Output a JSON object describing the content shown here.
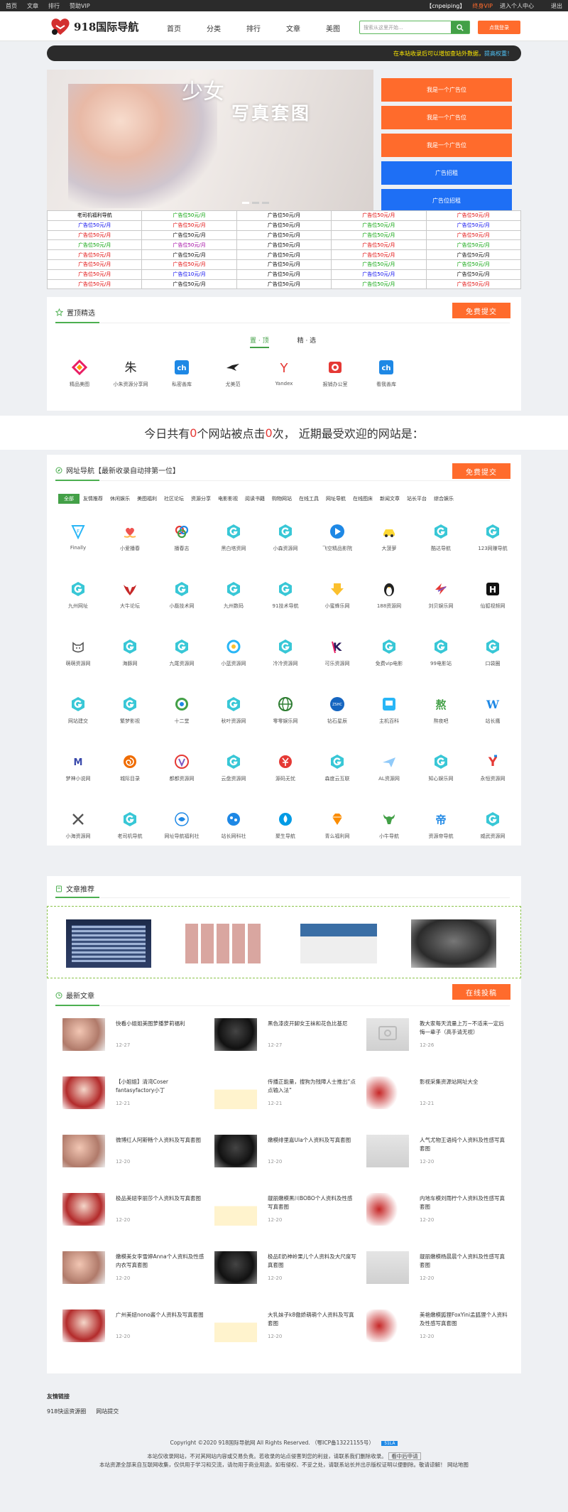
{
  "topbar": {
    "links": [
      "首页",
      "文章",
      "排行",
      "赞助VIP"
    ],
    "user": "【cnpeiping】",
    "vip": "终身VIP",
    "enter": "进入个人中心",
    "logout": "退出"
  },
  "header": {
    "logo_text": "918国际导航",
    "nav": [
      "首页",
      "分类",
      "排行",
      "文章",
      "美图"
    ],
    "search_placeholder": "搜索从这里开始...",
    "signin_label": "点我登录"
  },
  "notice": {
    "text": "在本站收录后可以增加查站外数据，",
    "highlight": "提高权重！"
  },
  "banner": {
    "brand": "少女",
    "title": "写真套图"
  },
  "side_ads": [
    {
      "label": "我是一个广告位",
      "color": "#ff6b2c"
    },
    {
      "label": "我是一个广告位",
      "color": "#ff6b2c"
    },
    {
      "label": "我是一个广告位",
      "color": "#ff6b2c"
    },
    {
      "label": "广告招租",
      "color": "#1e6ff5"
    },
    {
      "label": "广告位招租",
      "color": "#1e6ff5"
    }
  ],
  "ad_table": [
    [
      {
        "t": "老司机福利导航",
        "c": "#000"
      },
      {
        "t": "广告位50元/月",
        "c": "#00a000"
      },
      {
        "t": "广告位50元/月",
        "c": "#000"
      },
      {
        "t": "广告位50元/月",
        "c": "#e00000"
      },
      {
        "t": "广告位50元/月",
        "c": "#e00000"
      }
    ],
    [
      {
        "t": "广告位50元/月",
        "c": "#0000ee"
      },
      {
        "t": "广告位50元/月",
        "c": "#e00000"
      },
      {
        "t": "广告位50元/月",
        "c": "#000"
      },
      {
        "t": "广告位50元/月",
        "c": "#00a000"
      },
      {
        "t": "广告位50元/月",
        "c": "#0000ee"
      }
    ],
    [
      {
        "t": "广告位50元/月",
        "c": "#e00000"
      },
      {
        "t": "广告位50元/月",
        "c": "#000"
      },
      {
        "t": "广告位50元/月",
        "c": "#000"
      },
      {
        "t": "广告位50元/月",
        "c": "#00a000"
      },
      {
        "t": "广告位50元/月",
        "c": "#e00000"
      }
    ],
    [
      {
        "t": "广告位50元/月",
        "c": "#00a000"
      },
      {
        "t": "广告位50元/月",
        "c": "#a000a0"
      },
      {
        "t": "广告位50元/月",
        "c": "#000"
      },
      {
        "t": "广告位50元/月",
        "c": "#e00000"
      },
      {
        "t": "广告位50元/月",
        "c": "#00a000"
      }
    ],
    [
      {
        "t": "广告位50元/月",
        "c": "#e00000"
      },
      {
        "t": "广告位50元/月",
        "c": "#000"
      },
      {
        "t": "广告位50元/月",
        "c": "#000"
      },
      {
        "t": "广告位50元/月",
        "c": "#e00000"
      },
      {
        "t": "广告位50元/月",
        "c": "#000"
      }
    ],
    [
      {
        "t": "广告位50元/月",
        "c": "#e00000"
      },
      {
        "t": "广告位50元/月",
        "c": "#e00000"
      },
      {
        "t": "广告位50元/月",
        "c": "#000"
      },
      {
        "t": "广告位50元/月",
        "c": "#00a000"
      },
      {
        "t": "广告位50元/月",
        "c": "#00a000"
      }
    ],
    [
      {
        "t": "广告位50元/月",
        "c": "#e00000"
      },
      {
        "t": "广告位10元/月",
        "c": "#0000ee"
      },
      {
        "t": "广告位50元/月",
        "c": "#000"
      },
      {
        "t": "广告位50元/月",
        "c": "#0000ee"
      },
      {
        "t": "广告位50元/月",
        "c": "#000"
      }
    ],
    [
      {
        "t": "广告位50元/月",
        "c": "#e00000"
      },
      {
        "t": "广告位50元/月",
        "c": "#000"
      },
      {
        "t": "广告位50元/月",
        "c": "#000"
      },
      {
        "t": "广告位50元/月",
        "c": "#00a000"
      },
      {
        "t": "广告位50元/月",
        "c": "#e00000"
      }
    ]
  ],
  "featured": {
    "title": "置顶精选",
    "submit": "免费提交",
    "tabs": [
      "置 · 顶",
      "精 · 选"
    ],
    "items": [
      {
        "label": "精品美图",
        "icon": "diamond-logo-icon",
        "color": "#e91e63"
      },
      {
        "label": "小朱资源分享网",
        "icon": "zhu-logo-icon",
        "color": "#222"
      },
      {
        "label": "私密善库",
        "icon": "ch-logo-icon",
        "color": "#1e88e5"
      },
      {
        "label": "尤美范",
        "icon": "bird-logo-icon",
        "color": "#222"
      },
      {
        "label": "Yandex",
        "icon": "yandex-logo-icon",
        "color": "#e53935"
      },
      {
        "label": "报销办公室",
        "icon": "stamp-logo-icon",
        "color": "#e53935"
      },
      {
        "label": "看我善库",
        "icon": "ch-logo-icon",
        "color": "#1e88e5"
      }
    ]
  },
  "today": {
    "pre": "今日共有",
    "n1": "0",
    "mid": "个网站被点击",
    "n2": "0",
    "post": "次， 近期最受欢迎的网站是："
  },
  "sites": {
    "title": "网址导航【最新收录自动排第一位】",
    "submit": "免费提交",
    "tags": [
      "全部",
      "友情推荐",
      "休闲娱乐",
      "美图福利",
      "社区论坛",
      "资源分享",
      "电影影视",
      "阅读书籍",
      "购物网站",
      "在线工具",
      "网址导航",
      "在线图床",
      "新闻文章",
      "站长平台",
      "综合娱乐"
    ],
    "rows": [
      [
        {
          "l": "Finally",
          "i": "finally-logo-icon"
        },
        {
          "l": "小爱播春",
          "i": "hands-heart-icon"
        },
        {
          "l": "播春志",
          "i": "rings-logo-icon"
        },
        {
          "l": "黑白塔资网",
          "i": "g-logo-icon"
        },
        {
          "l": "小森资源网",
          "i": "g-logo-icon"
        },
        {
          "l": "飞空精品影院",
          "i": "play-logo-icon"
        },
        {
          "l": "大菠萝",
          "i": "car-logo-icon"
        },
        {
          "l": "酷达导航",
          "i": "g-logo-icon"
        },
        {
          "l": "123网赚导航",
          "i": "g-logo-icon"
        }
      ],
      [
        {
          "l": "九州网址",
          "i": "g-logo-icon"
        },
        {
          "l": "大牛论坛",
          "i": "bull-logo-icon"
        },
        {
          "l": "小磊技术网",
          "i": "g-logo-icon"
        },
        {
          "l": "九州数码",
          "i": "g-logo-icon"
        },
        {
          "l": "91技术导航",
          "i": "g-logo-icon"
        },
        {
          "l": "小蜜蜂乐网",
          "i": "arrow-down-logo-icon"
        },
        {
          "l": "188资源网",
          "i": "penguin-logo-icon"
        },
        {
          "l": "刘贝娱乐网",
          "i": "bolt-logo-icon"
        },
        {
          "l": "仙狐视频网",
          "i": "h-logo-icon"
        }
      ],
      [
        {
          "l": "萌萌资源网",
          "i": "cat-logo-icon"
        },
        {
          "l": "海豚网",
          "i": "g-logo-icon"
        },
        {
          "l": "九尾资源网",
          "i": "g-logo-icon"
        },
        {
          "l": "小蓝资源网",
          "i": "circle-logo-icon"
        },
        {
          "l": "冷冷资源网",
          "i": "g-logo-icon"
        },
        {
          "l": "可乐资源网",
          "i": "k-logo-icon"
        },
        {
          "l": "免费vip电影",
          "i": "g-logo-icon"
        },
        {
          "l": "99电影站",
          "i": "g-logo-icon"
        },
        {
          "l": "口袋圈",
          "i": "g-logo-icon"
        }
      ],
      [
        {
          "l": "网站建交",
          "i": "g-logo-icon"
        },
        {
          "l": "繁梦影视",
          "i": "g-logo-icon"
        },
        {
          "l": "十二堂",
          "i": "twelve-logo-icon"
        },
        {
          "l": "秋叶资源网",
          "i": "g-logo-icon"
        },
        {
          "l": "零零娱乐网",
          "i": "globe-logo-icon"
        },
        {
          "l": "钻石星辰",
          "i": "zshc-logo-icon"
        },
        {
          "l": "主机百科",
          "i": "monitor-logo-icon"
        },
        {
          "l": "熬夜吧",
          "i": "ao-logo-icon"
        },
        {
          "l": "站长鹰",
          "i": "w-logo-icon"
        }
      ],
      [
        {
          "l": "梦神小说网",
          "i": "m-logo-icon"
        },
        {
          "l": "城际目录",
          "i": "spiral-logo-icon"
        },
        {
          "l": "都都资源网",
          "i": "v-logo-icon"
        },
        {
          "l": "云盘资源网",
          "i": "g-logo-icon"
        },
        {
          "l": "源码无忧",
          "i": "yuan-logo-icon"
        },
        {
          "l": "森度云互联",
          "i": "g-logo-icon"
        },
        {
          "l": "AL资源网",
          "i": "plane-logo-icon"
        },
        {
          "l": "知心娱乐网",
          "i": "g-logo-icon"
        },
        {
          "l": "永恒资源网",
          "i": "y-logo-icon"
        }
      ],
      [
        {
          "l": "小海资源网",
          "i": "x-logo-icon"
        },
        {
          "l": "老司机导航",
          "i": "g-logo-icon"
        },
        {
          "l": "网址导航福利社",
          "i": "fish-logo-icon"
        },
        {
          "l": "站长网科社",
          "i": "globe-dots-icon"
        },
        {
          "l": "聚生导航",
          "i": "drop-logo-icon"
        },
        {
          "l": "青么福利网",
          "i": "gem-logo-icon"
        },
        {
          "l": "小牛导航",
          "i": "ox-logo-icon"
        },
        {
          "l": "资源帝导航",
          "i": "di-logo-icon"
        },
        {
          "l": "威武资源网",
          "i": "g-logo-icon"
        }
      ]
    ]
  },
  "recommend": {
    "title": "文章推荐"
  },
  "articles": {
    "title": "最新文章",
    "post_btn": "在线投稿",
    "items": [
      {
        "title": "快看小姐姐美图萝播萝莉福利",
        "date": "12-27"
      },
      {
        "title": "黑色漆皮开脚女王袜和花色比基尼",
        "date": "12-27"
      },
      {
        "title": "教大家每天流量上万~不适来一定后悔一辈子（高手请无视）",
        "date": "12-26"
      },
      {
        "title": "【小姐姐】清湾Coser fantasyfactory小丁",
        "date": "12-21"
      },
      {
        "title": "传播正能量，搜狗为残障人士推出“点点输入法”",
        "date": "12-21"
      },
      {
        "title": "影视采集资源站网址大全",
        "date": "12-21"
      },
      {
        "title": "微博红人阿斯畅个人资料及写真套图",
        "date": "12-20"
      },
      {
        "title": "嫩模绯里嘉Ula个人资料及写真套图",
        "date": "12-20"
      },
      {
        "title": "人气尤物王语纯个人资料及性感写真套图",
        "date": "12-20"
      },
      {
        "title": "极品美妞李丽莎个人资料及写真套图",
        "date": "12-20"
      },
      {
        "title": "靓丽嫩模黑川BOBO个人资料及性感写真套图",
        "date": "12-20"
      },
      {
        "title": "内地车模刘雨柠个人资料及性感写真套图",
        "date": "12-20"
      },
      {
        "title": "嫩模美女李雪婷Anna个人资料及性感内衣写真套图",
        "date": "12-20"
      },
      {
        "title": "极品E奶神岭果儿个人资料及大尺度写真套图",
        "date": "12-20"
      },
      {
        "title": "靓丽嫩模杨晨晨个人资料及性感写真套图",
        "date": "12-20"
      },
      {
        "title": "广州美妞nono酱个人资料及写真套图",
        "date": "12-20"
      },
      {
        "title": "大乳妹子k8傲娇萌萌个人资料及写真套图",
        "date": "12-20"
      },
      {
        "title": "美艳嫩模狐狸FoxYini孟狐狸个人资料及性感写真套图",
        "date": "12-20"
      }
    ]
  },
  "friends": {
    "title": "友情链接",
    "links": [
      "918快运资源圈",
      "网站提交"
    ]
  },
  "footer": {
    "line1": "Copyright ©2020 918国际导航网     All Rights Reserved.",
    "icp": "鄂ICP备13221155号",
    "badge": "51LA",
    "line2": "本站仅收录网站，不对其网站内容或交易负责。若收录的站点侵害到您的利益，请联系我们删除收录。",
    "line2b": "看中后申请",
    "line3": "本站资源全部来自互联网收集，仅供用于学习和交流，请勿用于商业用途。如有侵权、不妥之处，请联系站长并出示版权证明以便删除。敬请谅解！",
    "line3b": "网站地图"
  }
}
